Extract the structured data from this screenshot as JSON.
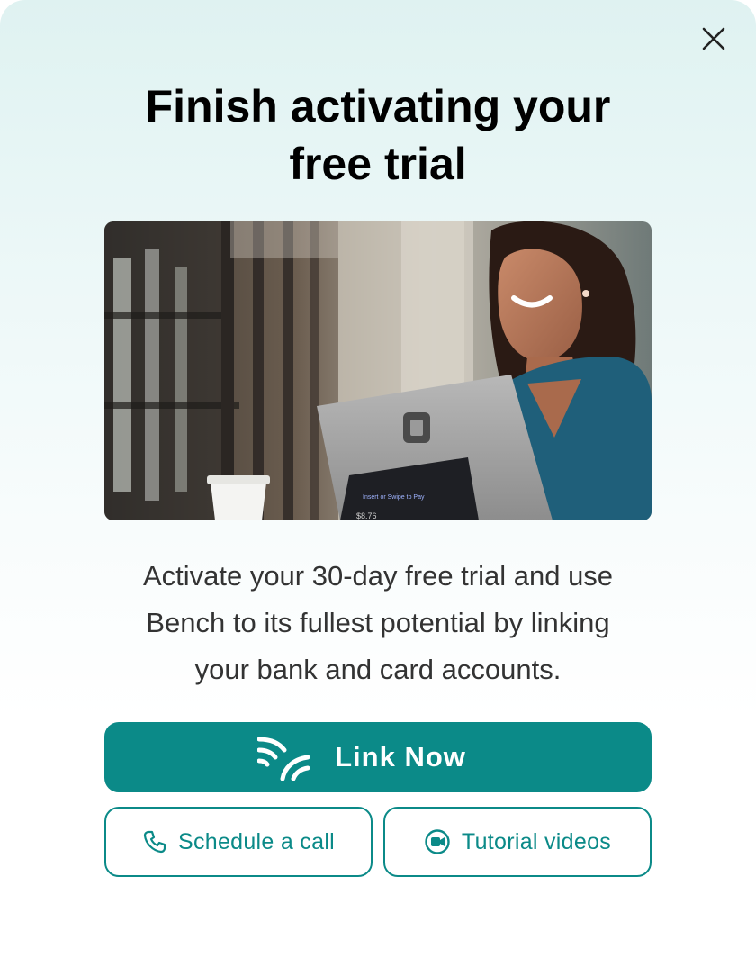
{
  "dialog": {
    "title_line1": "Finish activating your",
    "title_line2": "free trial",
    "body_line1": "Activate your 30-day free trial and use",
    "body_line2": "Bench to its fullest potential by linking",
    "body_line3": "your bank and card accounts.",
    "hero_screen_text": "Insert or Swipe to Pay",
    "hero_screen_amount": "$8.76"
  },
  "actions": {
    "primary_label": "Link Now",
    "primary_icon": "wireless-link-icon",
    "schedule_label": "Schedule a call",
    "schedule_icon": "phone-icon",
    "tutorial_label": "Tutorial videos",
    "tutorial_icon": "video-camera-icon",
    "close_icon": "close-icon"
  },
  "colors": {
    "accent": "#0b8a88",
    "title": "#000000",
    "body": "#333333",
    "background_top": "#dff2f1"
  }
}
